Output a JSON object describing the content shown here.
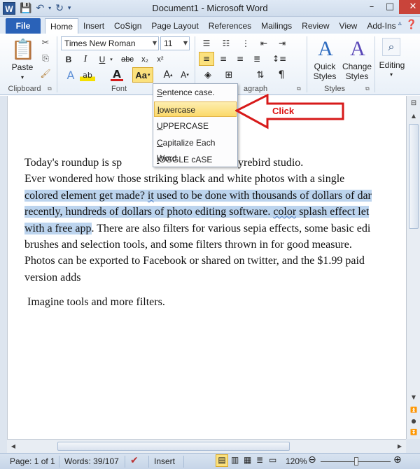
{
  "window": {
    "title": "Document1 - Microsoft Word",
    "app_icon_label": "W"
  },
  "tabs": {
    "file": "File",
    "items": [
      "Home",
      "Insert",
      "CoSign",
      "Page Layout",
      "References",
      "Mailings",
      "Review",
      "View",
      "Add-Ins"
    ]
  },
  "ribbon": {
    "clipboard": {
      "label": "Clipboard",
      "paste": "Paste"
    },
    "font": {
      "label": "Font",
      "font_name": "Times New Roman",
      "font_size": "11",
      "bold": "B",
      "italic": "I",
      "underline": "U",
      "strike": "abc",
      "subscript": "x₂",
      "superscript": "x²",
      "change_case": "Aa"
    },
    "paragraph": {
      "label": "agraph"
    },
    "styles": {
      "label": "Styles",
      "quick": "Quick",
      "quick2": "Styles",
      "change": "Change",
      "change2": "Styles"
    },
    "editing": {
      "label": "Editing"
    }
  },
  "change_case_menu": {
    "items": [
      "Sentence case.",
      "lowercase",
      "UPPERCASE",
      "Capitalize Each Word",
      "tOGGLE cASE"
    ],
    "highlighted_index": 1
  },
  "callout": {
    "label": "Click"
  },
  "document": {
    "line1": "Today's roundup is sp",
    "line1_end": "sh effect from lyrebird studio.",
    "line2": "Ever wondered how those striking black and white photos with a single",
    "line3_sel_a": "colored element get made? ",
    "line3_sel_b": "it",
    "line3_sel_c": " used to be done with thousands of dollars of dar",
    "line4_sel_a": "recently, hundreds of dollars of photo editing software. ",
    "line4_sel_b": "color",
    "line4_sel_c": " splash effect let",
    "line5_sel": "with a free app",
    "line5_rest": ". There are also filters for various sepia effects, some basic edi",
    "line6": "brushes and selection tools, and some filters thrown in for good measure.",
    "line7": "Photos can be exported to Facebook or shared on twitter, and the $1.99 paid",
    "line8": "version adds",
    "para2": "Imagine tools and more filters."
  },
  "status": {
    "page": "Page: 1 of 1",
    "words": "Words: 39/107",
    "mode": "Insert",
    "zoom": "120%"
  }
}
